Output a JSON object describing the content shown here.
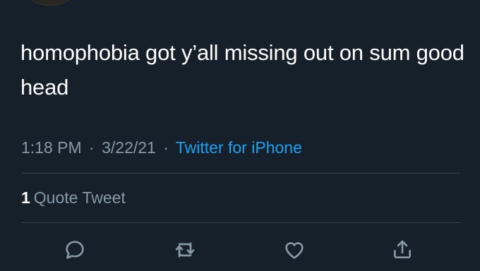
{
  "tweet": {
    "text": "homophobia got y’all missing out on sum good head",
    "time": "1:18 PM",
    "separator": "·",
    "date": "3/22/21",
    "source": "Twitter for iPhone",
    "quote_count": "1",
    "quote_label": "Quote Tweet"
  },
  "actions": {
    "reply_icon": "reply-icon",
    "retweet_icon": "retweet-icon",
    "like_icon": "heart-icon",
    "share_icon": "share-icon"
  },
  "colors": {
    "background": "#15202b",
    "text": "#ffffff",
    "muted": "#8899a6",
    "link": "#1da1f2",
    "divider": "#38444d"
  }
}
